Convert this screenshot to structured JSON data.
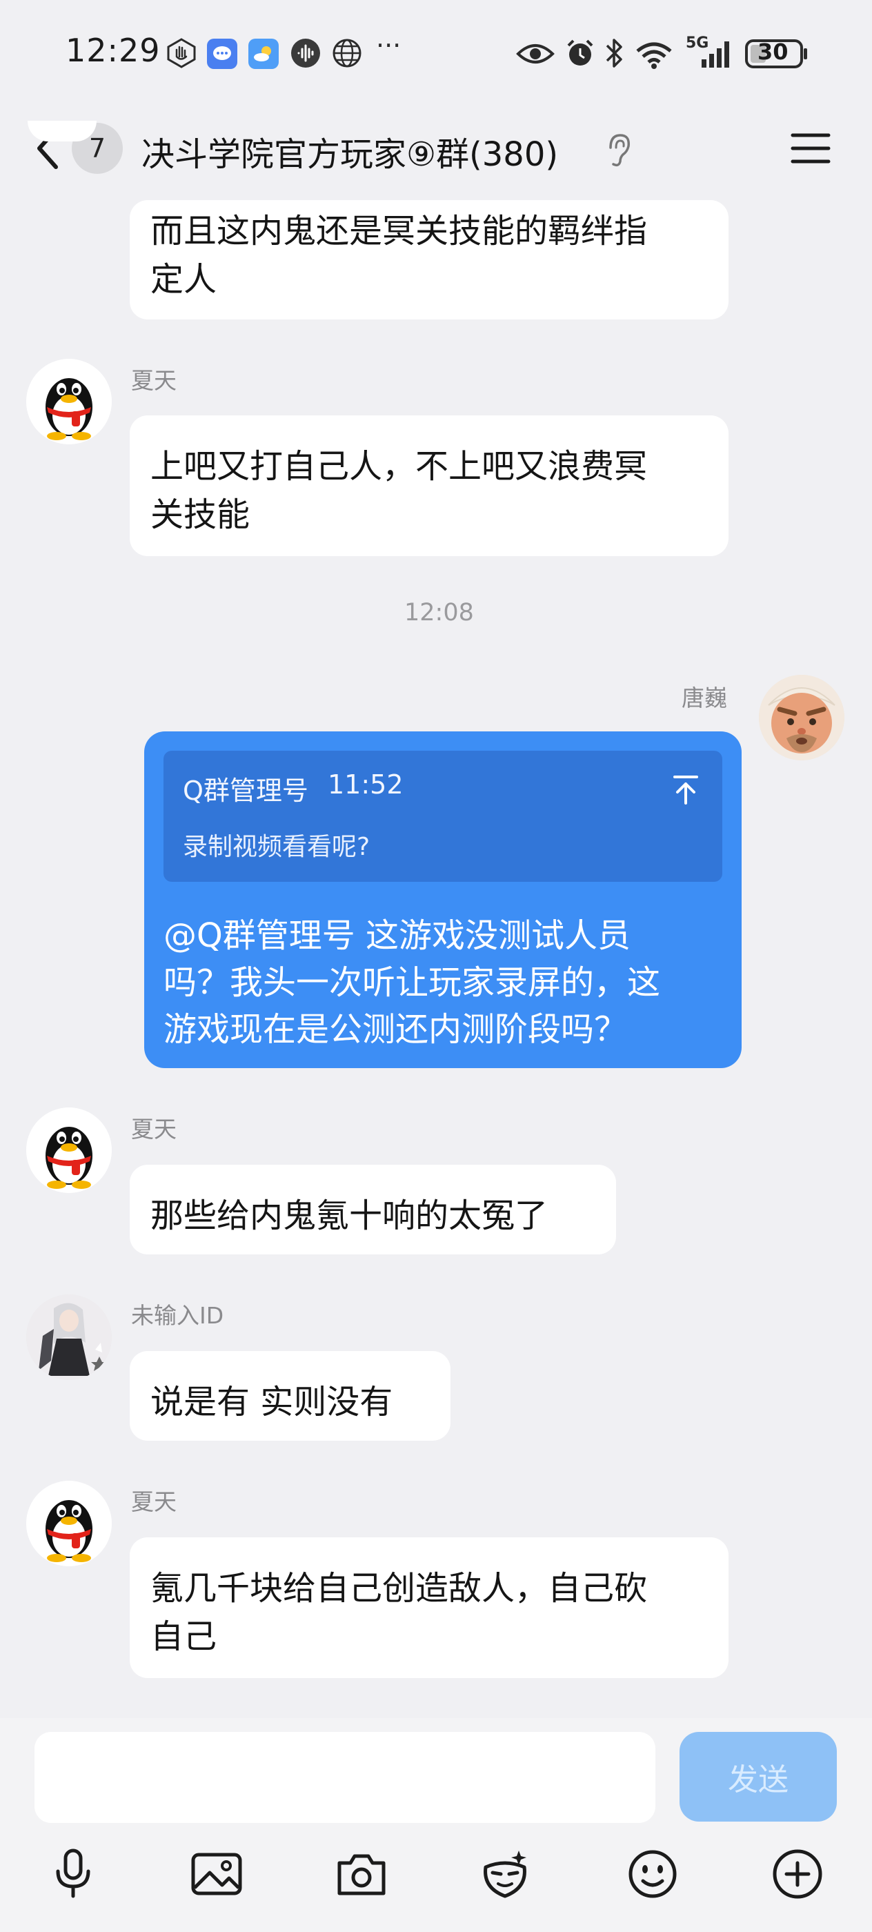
{
  "status_bar": {
    "time": "12:29",
    "network_label": "5G",
    "battery": "30",
    "icons": [
      "hand-icon",
      "message-app-icon",
      "weather-icon",
      "audio-icon",
      "globe-icon",
      "more-icon",
      "eye-icon",
      "alarm-icon",
      "bluetooth-icon",
      "wifi-icon",
      "signal-icon",
      "battery-icon"
    ]
  },
  "header": {
    "unread_count": "7",
    "title": "决斗学院官方玩家⑨群(380)",
    "icons": [
      "back-chevron-icon",
      "ear-icon",
      "menu-icon"
    ]
  },
  "messages": [
    {
      "kind": "text",
      "text_lines": [
        "而且这内鬼还是冥关技能的羁绊指",
        "定人"
      ]
    },
    {
      "kind": "text",
      "sender": "夏天",
      "text_lines": [
        "上吧又打自己人，不上吧又浪费冥",
        "关技能"
      ]
    },
    {
      "kind": "timestamp",
      "text": "12:08"
    },
    {
      "kind": "quote",
      "sender": "唐巍",
      "quote_author": "Q群管理号",
      "quote_time": "11:52",
      "quote_text": "录制视频看看呢?",
      "text_lines": [
        "@Q群管理号 这游戏没测试人员",
        "吗？我头一次听让玩家录屏的，这",
        "游戏现在是公测还内测阶段吗？"
      ]
    },
    {
      "kind": "text",
      "sender": "夏天",
      "text_lines": [
        "那些给内鬼氪十响的太冤了"
      ]
    },
    {
      "kind": "text",
      "sender": "未输入ID",
      "text_lines": [
        "说是有 实则没有"
      ]
    },
    {
      "kind": "text",
      "sender": "夏天",
      "text_lines": [
        "氪几千块给自己创造敌人，自己砍",
        "自己"
      ]
    }
  ],
  "composer": {
    "input_value": "",
    "send_label": "发送",
    "toolbar": [
      "microphone-icon",
      "image-icon",
      "camera-icon",
      "sticker-icon",
      "emoji-icon",
      "plus-icon"
    ]
  },
  "colors": {
    "background": "#f0f0f3",
    "self_bubble": "#3d8ef5",
    "quote_box": "#3276d8",
    "send_button": "#8ec1f6"
  }
}
